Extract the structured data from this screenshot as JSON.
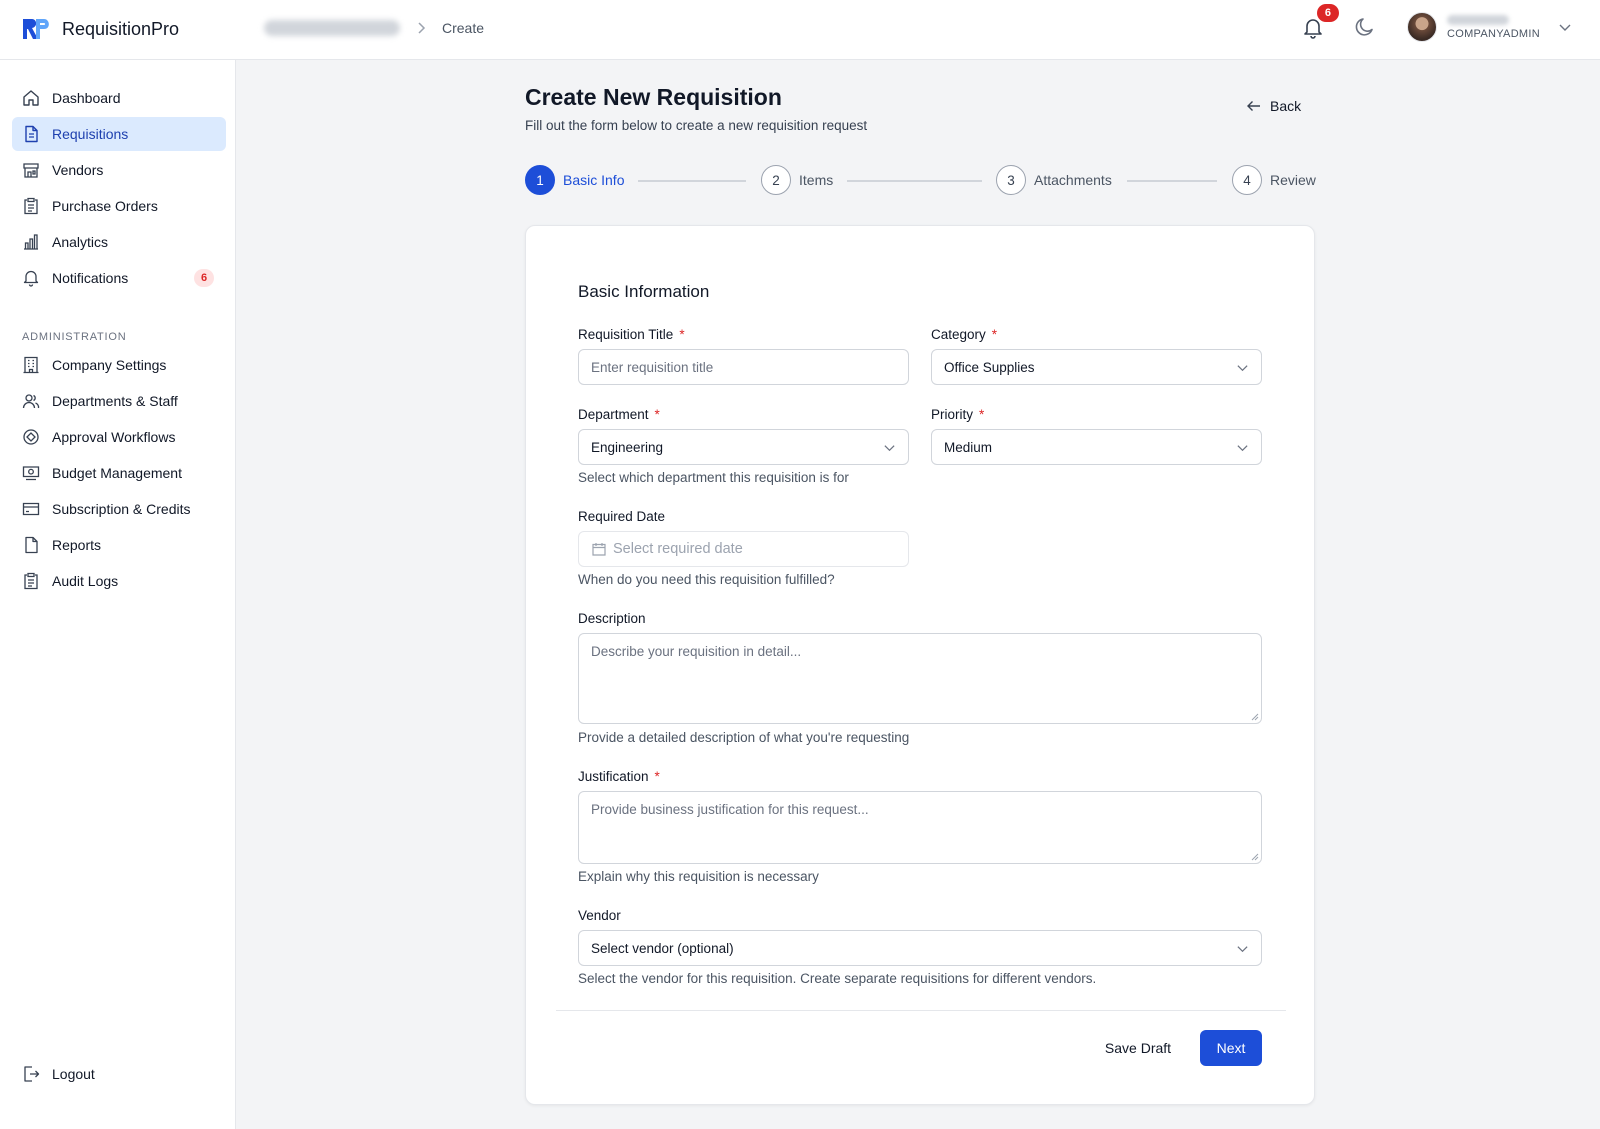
{
  "app": {
    "name": "RequisitionPro"
  },
  "breadcrumb": {
    "current": "Create"
  },
  "header": {
    "notification_count": "6",
    "user_role": "COMPANYADMIN"
  },
  "sidebar": {
    "items": [
      {
        "label": "Dashboard",
        "icon": "home-icon"
      },
      {
        "label": "Requisitions",
        "icon": "document-icon",
        "active": true
      },
      {
        "label": "Vendors",
        "icon": "store-icon"
      },
      {
        "label": "Purchase Orders",
        "icon": "clipboard-icon"
      },
      {
        "label": "Analytics",
        "icon": "bar-chart-icon"
      },
      {
        "label": "Notifications",
        "icon": "bell-icon",
        "count": "6"
      }
    ],
    "section_title": "ADMINISTRATION",
    "admin_items": [
      {
        "label": "Company Settings",
        "icon": "building-icon"
      },
      {
        "label": "Departments & Staff",
        "icon": "users-icon"
      },
      {
        "label": "Approval Workflows",
        "icon": "workflow-icon"
      },
      {
        "label": "Budget Management",
        "icon": "budget-icon"
      },
      {
        "label": "Subscription & Credits",
        "icon": "credit-card-icon"
      },
      {
        "label": "Reports",
        "icon": "report-icon"
      },
      {
        "label": "Audit Logs",
        "icon": "audit-icon"
      }
    ],
    "logout": "Logout"
  },
  "page": {
    "title": "Create New Requisition",
    "subtitle": "Fill out the form below to create a new requisition request",
    "back_label": "Back"
  },
  "steps": [
    {
      "number": "1",
      "label": "Basic Info",
      "active": true
    },
    {
      "number": "2",
      "label": "Items"
    },
    {
      "number": "3",
      "label": "Attachments"
    },
    {
      "number": "4",
      "label": "Review"
    }
  ],
  "form": {
    "section_title": "Basic Information",
    "title": {
      "label": "Requisition Title",
      "placeholder": "Enter requisition title"
    },
    "category": {
      "label": "Category",
      "value": "Office Supplies"
    },
    "department": {
      "label": "Department",
      "value": "Engineering",
      "help": "Select which department this requisition is for"
    },
    "priority": {
      "label": "Priority",
      "value": "Medium"
    },
    "required_date": {
      "label": "Required Date",
      "placeholder": "Select required date",
      "help": "When do you need this requisition fulfilled?"
    },
    "description": {
      "label": "Description",
      "placeholder": "Describe your requisition in detail...",
      "help": "Provide a detailed description of what you're requesting"
    },
    "justification": {
      "label": "Justification",
      "placeholder": "Provide business justification for this request...",
      "help": "Explain why this requisition is necessary"
    },
    "vendor": {
      "label": "Vendor",
      "value": "Select vendor (optional)",
      "help": "Select the vendor for this requisition. Create separate requisitions for different vendors."
    },
    "save_draft": "Save Draft",
    "next": "Next"
  },
  "colors": {
    "accent": "#1d4ed8",
    "active_bg": "#dbeafe",
    "danger": "#dc2626"
  }
}
